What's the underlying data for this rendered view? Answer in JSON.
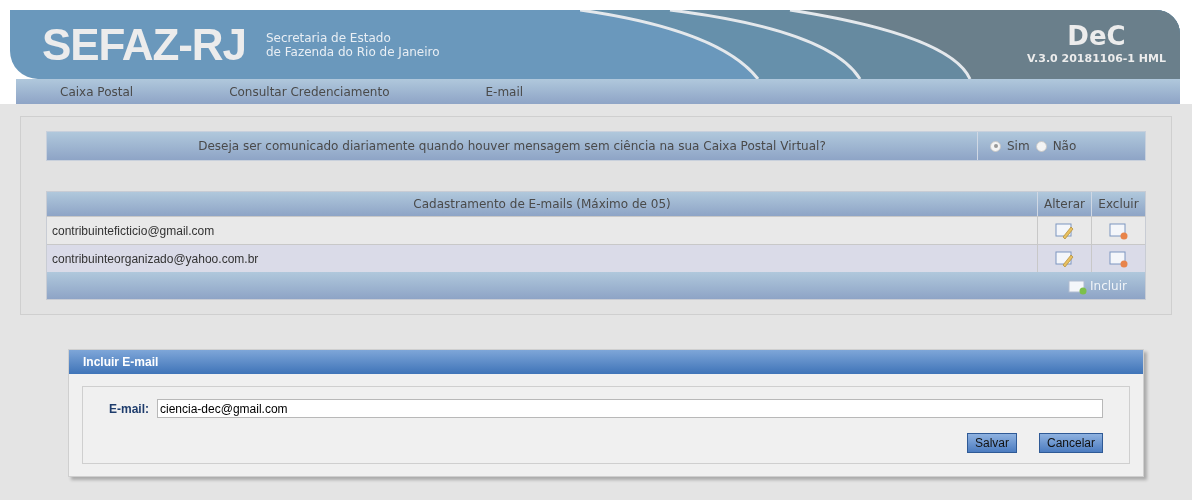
{
  "header": {
    "logo": "SEFAZ-RJ",
    "subtitle_1": "Secretaria de Estado",
    "subtitle_2": "de Fazenda do Rio de Janeiro",
    "app_name": "DeC",
    "version": "V.3.0 20181106-1 HML"
  },
  "nav": [
    {
      "label": "Caixa Postal"
    },
    {
      "label": "Consultar Credenciamento"
    },
    {
      "label": "E-mail"
    }
  ],
  "question": {
    "text": "Deseja ser comunicado diariamente quando houver mensagem sem ciência na sua Caixa Postal Virtual?",
    "options": [
      {
        "label": "Sim",
        "selected": true
      },
      {
        "label": "Não",
        "selected": false
      }
    ]
  },
  "table": {
    "columns": [
      "Cadastramento de E-mails (Máximo de 05)",
      "Alterar",
      "Excluir"
    ],
    "rows": [
      {
        "email": "contribuinteficticio@gmail.com"
      },
      {
        "email": "contribuinteorganizado@yahoo.com.br"
      }
    ],
    "add_label": "Incluir"
  },
  "dialog": {
    "title": "Incluir E-mail",
    "field_label": "E-mail:",
    "value": "ciencia-dec@gmail.com",
    "buttons": [
      "Salvar",
      "Cancelar"
    ]
  }
}
